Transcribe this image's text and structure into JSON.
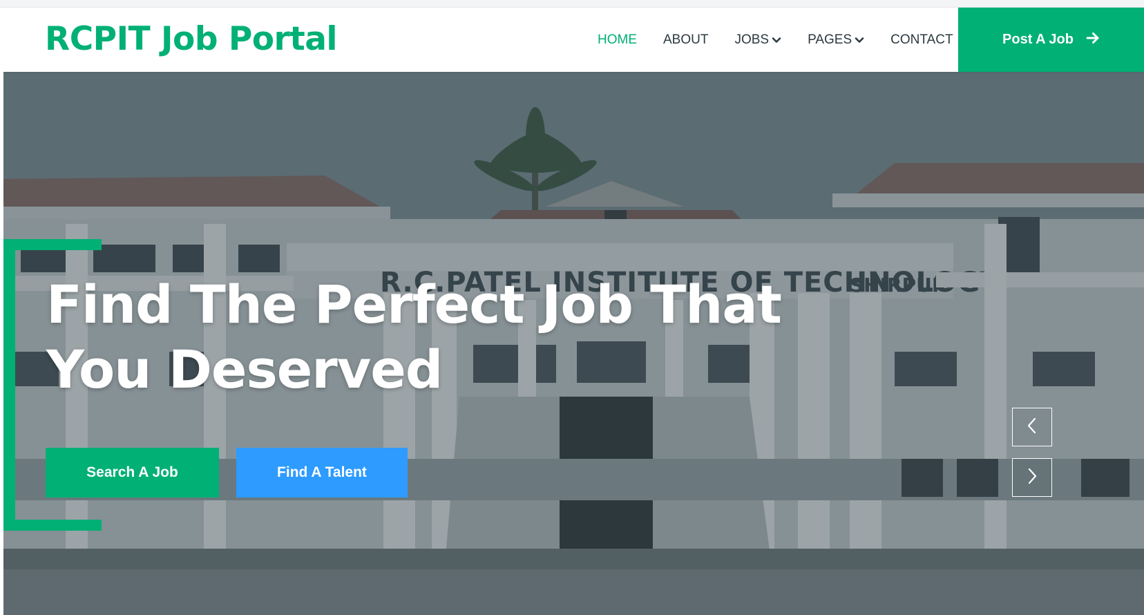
{
  "brand": {
    "name": "RCPIT Job Portal"
  },
  "nav": {
    "home": "HOME",
    "about": "ABOUT",
    "jobs": "JOBS",
    "pages": "PAGES",
    "contact": "CONTACT",
    "active": "HOME"
  },
  "post_job": {
    "label": "Post A Job",
    "icon": "arrow-right-icon"
  },
  "hero": {
    "headline_line1": "Find The Perfect Job That",
    "headline_line2": "You Deserved",
    "background_sign": "R.C.PATEL INSTITUTE OF TECHNOLOGY",
    "background_sign_suffix": "SHIRPUR",
    "search_button": "Search A Job",
    "talent_button": "Find A Talent",
    "prev_icon": "chevron-left-icon",
    "next_icon": "chevron-right-icon"
  },
  "colors": {
    "primary": "#00b074",
    "secondary": "#2d9bff",
    "dark": "#2b3940"
  }
}
